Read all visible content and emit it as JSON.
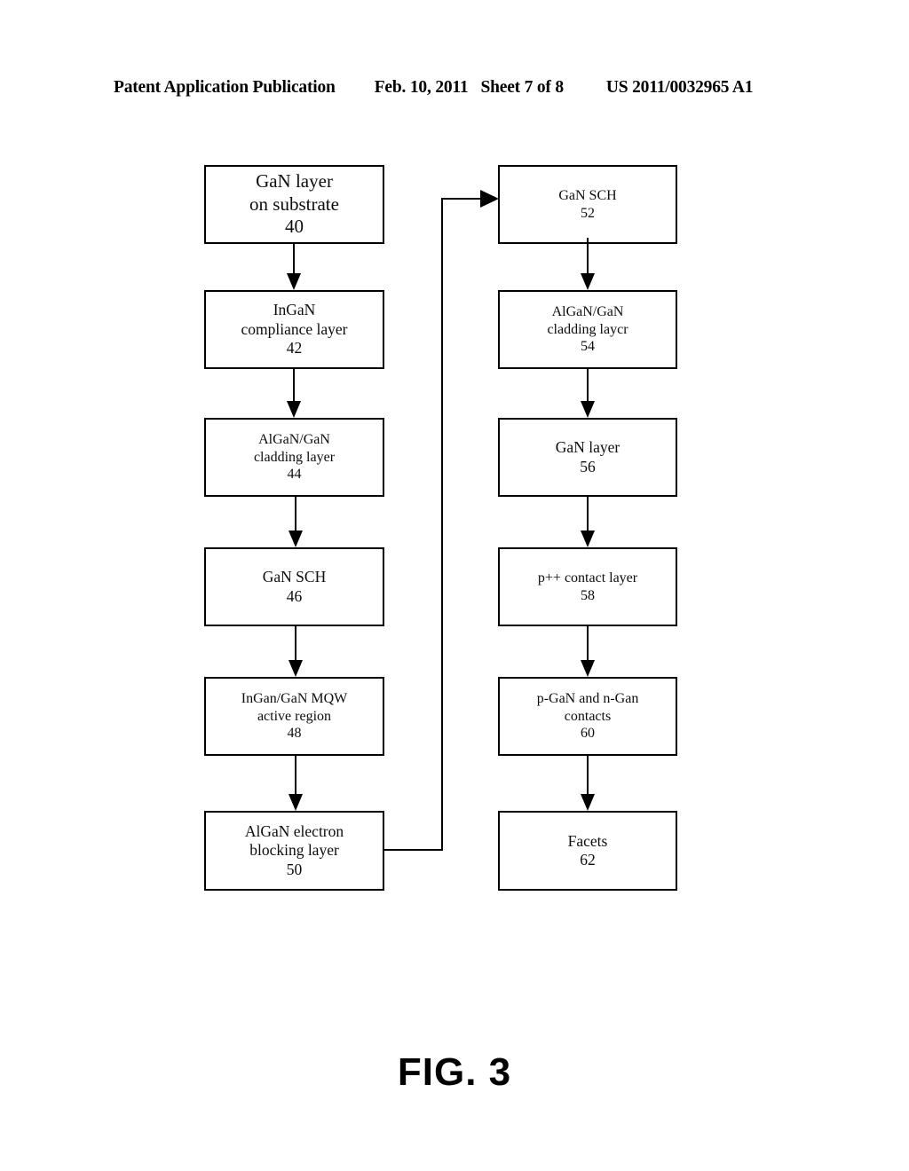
{
  "header": {
    "title": "Patent Application Publication",
    "date": "Feb. 10, 2011",
    "sheet": "Sheet 7 of 8",
    "publication_number": "US 2011/0032965 A1"
  },
  "figure": {
    "caption": "FIG. 3",
    "type": "process-flow-chart"
  },
  "flowchart": {
    "left_column": [
      {
        "id": "40",
        "lines": [
          "GaN layer",
          "on substrate"
        ],
        "ref": "40",
        "line1": "GaN layer",
        "line2": "on substrate"
      },
      {
        "id": "42",
        "lines": [
          "InGaN",
          "compliance layer"
        ],
        "ref": "42",
        "line1": "InGaN",
        "line2": "compliance layer"
      },
      {
        "id": "44",
        "lines": [
          "AlGaN/GaN",
          "cladding layer"
        ],
        "ref": "44",
        "line1": "AlGaN/GaN",
        "line2": "cladding layer"
      },
      {
        "id": "46",
        "lines": [
          "GaN SCH"
        ],
        "ref": "46",
        "line1": "GaN SCH",
        "line2": ""
      },
      {
        "id": "48",
        "lines": [
          "InGan/GaN MQW",
          "active region"
        ],
        "ref": "48",
        "line1": "InGan/GaN MQW",
        "line2": "active region"
      },
      {
        "id": "50",
        "lines": [
          "AlGaN electron",
          "blocking layer"
        ],
        "ref": "50",
        "line1": "AlGaN electron",
        "line2": "blocking layer"
      }
    ],
    "right_column": [
      {
        "id": "52",
        "lines": [
          "GaN SCH"
        ],
        "ref": "52",
        "line1": "GaN SCH",
        "line2": ""
      },
      {
        "id": "54",
        "lines": [
          "AlGaN/GaN",
          "cladding laycr"
        ],
        "ref": "54",
        "line1": "AlGaN/GaN",
        "line2": "cladding laycr"
      },
      {
        "id": "56",
        "lines": [
          "GaN layer"
        ],
        "ref": "56",
        "line1": "GaN layer",
        "line2": ""
      },
      {
        "id": "58",
        "lines": [
          "p++ contact layer"
        ],
        "ref": "58",
        "line1": "p++ contact layer",
        "line2": ""
      },
      {
        "id": "60",
        "lines": [
          "p-GaN and n-Gan",
          "contacts"
        ],
        "ref": "60",
        "line1": "p-GaN and n-Gan",
        "line2": "contacts"
      },
      {
        "id": "62",
        "lines": [
          "Facets"
        ],
        "ref": "62",
        "line1": "Facets",
        "line2": ""
      }
    ],
    "connections": [
      {
        "from": "40",
        "to": "42",
        "style": "arrow-down"
      },
      {
        "from": "42",
        "to": "44",
        "style": "arrow-down"
      },
      {
        "from": "44",
        "to": "46",
        "style": "arrow-down"
      },
      {
        "from": "46",
        "to": "48",
        "style": "arrow-down"
      },
      {
        "from": "48",
        "to": "50",
        "style": "arrow-down"
      },
      {
        "from": "50",
        "to": "52",
        "style": "elbow-right-up-arrow-right"
      },
      {
        "from": "52",
        "to": "54",
        "style": "arrow-down"
      },
      {
        "from": "54",
        "to": "56",
        "style": "arrow-down"
      },
      {
        "from": "56",
        "to": "58",
        "style": "arrow-down"
      },
      {
        "from": "58",
        "to": "60",
        "style": "arrow-down"
      },
      {
        "from": "60",
        "to": "62",
        "style": "arrow-down"
      }
    ]
  },
  "colors": {
    "ink": "#000000",
    "paper": "#ffffff"
  }
}
